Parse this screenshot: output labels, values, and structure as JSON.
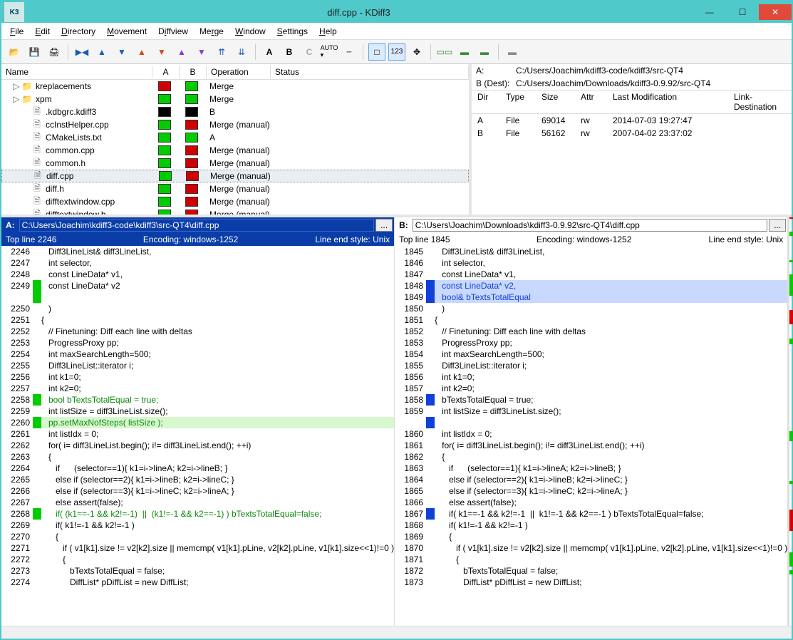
{
  "window": {
    "title": "diff.cpp - KDiff3"
  },
  "menus": [
    "File",
    "Edit",
    "Directory",
    "Movement",
    "Diffview",
    "Merge",
    "Window",
    "Settings",
    "Help"
  ],
  "dirColumns": {
    "name": "Name",
    "a": "A",
    "b": "B",
    "op": "Operation",
    "status": "Status"
  },
  "files": [
    {
      "name": "kreplacements",
      "type": "folder",
      "indent": 1,
      "expander": "▷",
      "a": "red",
      "b": "green",
      "op": "Merge"
    },
    {
      "name": "xpm",
      "type": "folder",
      "indent": 1,
      "expander": "▷",
      "a": "green",
      "b": "green",
      "op": "Merge"
    },
    {
      "name": ".kdbgrc.kdiff3",
      "type": "file",
      "indent": 2,
      "a": "black",
      "b": "black",
      "op": "B"
    },
    {
      "name": "ccInstHelper.cpp",
      "type": "file",
      "indent": 2,
      "a": "green",
      "b": "red",
      "op": "Merge (manual)"
    },
    {
      "name": "CMakeLists.txt",
      "type": "file",
      "indent": 2,
      "a": "green",
      "b": "green",
      "op": "A"
    },
    {
      "name": "common.cpp",
      "type": "file",
      "indent": 2,
      "a": "green",
      "b": "red",
      "op": "Merge (manual)"
    },
    {
      "name": "common.h",
      "type": "file",
      "indent": 2,
      "a": "green",
      "b": "red",
      "op": "Merge (manual)"
    },
    {
      "name": "diff.cpp",
      "type": "file",
      "indent": 2,
      "a": "green",
      "b": "red",
      "op": "Merge (manual)",
      "selected": true
    },
    {
      "name": "diff.h",
      "type": "file",
      "indent": 2,
      "a": "green",
      "b": "red",
      "op": "Merge (manual)"
    },
    {
      "name": "difftextwindow.cpp",
      "type": "file",
      "indent": 2,
      "a": "green",
      "b": "red",
      "op": "Merge (manual)"
    },
    {
      "name": "difftextwindow.h",
      "type": "file",
      "indent": 2,
      "a": "green",
      "b": "red",
      "op": "Merge (manual)"
    }
  ],
  "info": {
    "A": {
      "lbl": "A:",
      "path": "C:/Users/Joachim/kdiff3-code/kdiff3/src-QT4"
    },
    "B": {
      "lbl": "B (Dest):",
      "path": "C:/Users/Joachim/Downloads/kdiff3-0.9.92/src-QT4"
    },
    "head": {
      "dir": "Dir",
      "type": "Type",
      "size": "Size",
      "attr": "Attr",
      "mod": "Last Modification",
      "ld": "Link-Destination"
    },
    "rows": [
      {
        "dir": "A",
        "type": "File",
        "size": "69014",
        "attr": "rw",
        "mod": "2014-07-03 19:27:47"
      },
      {
        "dir": "B",
        "type": "File",
        "size": "56162",
        "attr": "rw",
        "mod": "2007-04-02 23:37:02"
      }
    ]
  },
  "paneA": {
    "label": "A:",
    "path": "C:\\Users\\Joachim\\kdiff3-code\\kdiff3\\src-QT4\\diff.cpp",
    "top": "Top line 2246",
    "enc": "Encoding: windows-1252",
    "eol": "Line end style: Unix",
    "lines": [
      {
        "n": "2246",
        "t": "   Diff3LineList& diff3LineList,"
      },
      {
        "n": "2247",
        "t": "   int selector,"
      },
      {
        "n": "2248",
        "t": "   const LineData* v1,"
      },
      {
        "n": "2249",
        "t": "   const LineData* v2",
        "mark": "g"
      },
      {
        "n": "",
        "t": "",
        "mark": "g"
      },
      {
        "n": "2250",
        "t": "   )"
      },
      {
        "n": "2251",
        "t": "{"
      },
      {
        "n": "2252",
        "t": "   // Finetuning: Diff each line with deltas"
      },
      {
        "n": "2253",
        "t": "   ProgressProxy pp;"
      },
      {
        "n": "2254",
        "t": "   int maxSearchLength=500;"
      },
      {
        "n": "2255",
        "t": "   Diff3LineList::iterator i;"
      },
      {
        "n": "2256",
        "t": "   int k1=0;"
      },
      {
        "n": "2257",
        "t": "   int k2=0;"
      },
      {
        "n": "2258",
        "t": "   bool bTextsTotalEqual = true;",
        "mark": "g",
        "cls": "c-green"
      },
      {
        "n": "2259",
        "t": "   int listSize = diff3LineList.size();"
      },
      {
        "n": "2260",
        "t": "   pp.setMaxNofSteps( listSize );",
        "mark": "g",
        "cls": "c-hlg"
      },
      {
        "n": "2261",
        "t": "   int listIdx = 0;"
      },
      {
        "n": "2262",
        "t": "   for( i= diff3LineList.begin(); i!= diff3LineList.end(); ++i)"
      },
      {
        "n": "2263",
        "t": "   {"
      },
      {
        "n": "2264",
        "t": "      if      (selector==1){ k1=i->lineA; k2=i->lineB; }"
      },
      {
        "n": "2265",
        "t": "      else if (selector==2){ k1=i->lineB; k2=i->lineC; }"
      },
      {
        "n": "2266",
        "t": "      else if (selector==3){ k1=i->lineC; k2=i->lineA; }"
      },
      {
        "n": "2267",
        "t": "      else assert(false);"
      },
      {
        "n": "2268",
        "t": "      if( (k1==-1 && k2!=-1)  ||  (k1!=-1 && k2==-1) ) bTextsTotalEqual=false;",
        "mark": "g",
        "cls": "c-green"
      },
      {
        "n": "2269",
        "t": "      if( k1!=-1 && k2!=-1 )"
      },
      {
        "n": "2270",
        "t": "      {"
      },
      {
        "n": "2271",
        "t": "         if ( v1[k1].size != v2[k2].size || memcmp( v1[k1].pLine, v2[k2].pLine, v1[k1].size<<1)!=0 )"
      },
      {
        "n": "2272",
        "t": "         {"
      },
      {
        "n": "2273",
        "t": "            bTextsTotalEqual = false;"
      },
      {
        "n": "2274",
        "t": "            DiffList* pDiffList = new DiffList;"
      }
    ]
  },
  "paneB": {
    "label": "B:",
    "path": "C:\\Users\\Joachim\\Downloads\\kdiff3-0.9.92\\src-QT4\\diff.cpp",
    "top": "Top line 1845",
    "enc": "Encoding: windows-1252",
    "eol": "Line end style: Unix",
    "lines": [
      {
        "n": "1845",
        "t": "   Diff3LineList& diff3LineList,"
      },
      {
        "n": "1846",
        "t": "   int selector,"
      },
      {
        "n": "1847",
        "t": "   const LineData* v1,"
      },
      {
        "n": "1848",
        "t": "   const LineData* v2,",
        "mark": "b",
        "cls": "c-blue"
      },
      {
        "n": "1849",
        "t": "   bool& bTextsTotalEqual",
        "mark": "b",
        "cls": "c-blue"
      },
      {
        "n": "1850",
        "t": "   )"
      },
      {
        "n": "1851",
        "t": "{"
      },
      {
        "n": "1852",
        "t": "   // Finetuning: Diff each line with deltas"
      },
      {
        "n": "1853",
        "t": "   ProgressProxy pp;"
      },
      {
        "n": "1854",
        "t": "   int maxSearchLength=500;"
      },
      {
        "n": "1855",
        "t": "   Diff3LineList::iterator i;"
      },
      {
        "n": "1856",
        "t": "   int k1=0;"
      },
      {
        "n": "1857",
        "t": "   int k2=0;"
      },
      {
        "n": "1858",
        "t": "   bTextsTotalEqual = true;",
        "mark": "b"
      },
      {
        "n": "1859",
        "t": "   int listSize = diff3LineList.size();"
      },
      {
        "n": "",
        "t": "",
        "mark": "b"
      },
      {
        "n": "1860",
        "t": "   int listIdx = 0;"
      },
      {
        "n": "1861",
        "t": "   for( i= diff3LineList.begin(); i!= diff3LineList.end(); ++i)"
      },
      {
        "n": "1862",
        "t": "   {"
      },
      {
        "n": "1863",
        "t": "      if      (selector==1){ k1=i->lineA; k2=i->lineB; }"
      },
      {
        "n": "1864",
        "t": "      else if (selector==2){ k1=i->lineB; k2=i->lineC; }"
      },
      {
        "n": "1865",
        "t": "      else if (selector==3){ k1=i->lineC; k2=i->lineA; }"
      },
      {
        "n": "1866",
        "t": "      else assert(false);"
      },
      {
        "n": "1867",
        "t": "      if( k1==-1 && k2!=-1  ||  k1!=-1 && k2==-1 ) bTextsTotalEqual=false;",
        "mark": "b"
      },
      {
        "n": "1868",
        "t": "      if( k1!=-1 && k2!=-1 )"
      },
      {
        "n": "1869",
        "t": "      {"
      },
      {
        "n": "1870",
        "t": "         if ( v1[k1].size != v2[k2].size || memcmp( v1[k1].pLine, v2[k2].pLine, v1[k1].size<<1)!=0 )"
      },
      {
        "n": "1871",
        "t": "         {"
      },
      {
        "n": "1872",
        "t": "            bTextsTotalEqual = false;"
      },
      {
        "n": "1873",
        "t": "            DiffList* pDiffList = new DiffList;"
      }
    ]
  }
}
